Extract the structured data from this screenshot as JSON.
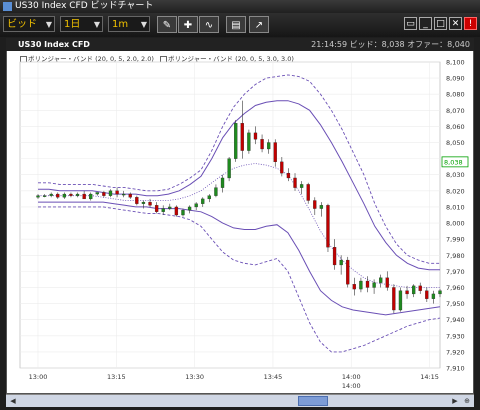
{
  "window": {
    "title": "US30 Index CFD ビッドチャート"
  },
  "toolbar": {
    "price_type": "ビッド",
    "period": "1日",
    "interval": "1m",
    "tool_icons": [
      "pen-icon",
      "pin-icon",
      "tilde-icon",
      "print-icon",
      "export-icon"
    ],
    "window_controls": [
      "window-icon",
      "minimize-icon",
      "maximize-icon",
      "close-icon",
      "alert-icon"
    ]
  },
  "chart_header": {
    "symbol": "US30 Index CFD",
    "status": "21:14:59  ビッド：8,038  オファー：8,040"
  },
  "legend": {
    "item1": "ボリンジャー・バンド (20, 0, 5, 2.0, 2.0)",
    "item2": "ボリンジャー・バンド (20, 0, 5, 3.0, 3.0)"
  },
  "colors": {
    "up": "#1f8a1f",
    "down": "#c00000",
    "band": "#6a4fb5",
    "accent": "#00a000"
  },
  "chart_data": {
    "type": "candlestick",
    "ylim": [
      7910,
      8100
    ],
    "yticks": [
      8100,
      8090,
      8080,
      8070,
      8060,
      8050,
      8040,
      8030,
      8020,
      8010,
      8000,
      7990,
      7980,
      7970,
      7960,
      7950,
      7940,
      7930,
      7920,
      7910
    ],
    "xticks": [
      {
        "label": "13:00",
        "t": 0
      },
      {
        "label": "13:15",
        "t": 15
      },
      {
        "label": "13:30",
        "t": 30
      },
      {
        "label": "13:45",
        "t": 45
      },
      {
        "label": "14:00",
        "t": 60
      },
      {
        "label": "14:15",
        "t": 75
      }
    ],
    "x_sublabel": {
      "label": "14:00",
      "t": 60
    },
    "last_price": "8,038",
    "candles": [
      [
        8016,
        8018,
        8015,
        8017
      ],
      [
        8017,
        8018,
        8016,
        8017
      ],
      [
        8017,
        8019,
        8016,
        8018
      ],
      [
        8018,
        8019,
        8015,
        8016
      ],
      [
        8016,
        8019,
        8015,
        8018
      ],
      [
        8018,
        8019,
        8016,
        8017
      ],
      [
        8017,
        8019,
        8016,
        8018
      ],
      [
        8018,
        8020,
        8015,
        8015
      ],
      [
        8015,
        8019,
        8014,
        8018
      ],
      [
        8018,
        8019,
        8017,
        8019
      ],
      [
        8019,
        8020,
        8016,
        8017
      ],
      [
        8017,
        8021,
        8016,
        8020
      ],
      [
        8020,
        8022,
        8016,
        8018
      ],
      [
        8018,
        8020,
        8016,
        8018
      ],
      [
        8018,
        8019,
        8015,
        8016
      ],
      [
        8016,
        8017,
        8011,
        8012
      ],
      [
        8012,
        8014,
        8009,
        8013
      ],
      [
        8013,
        8015,
        8010,
        8011
      ],
      [
        8011,
        8013,
        8006,
        8007
      ],
      [
        8007,
        8011,
        8005,
        8009
      ],
      [
        8009,
        8012,
        8008,
        8010
      ],
      [
        8010,
        8011,
        8004,
        8005
      ],
      [
        8005,
        8009,
        8004,
        8008
      ],
      [
        8008,
        8011,
        8006,
        8010
      ],
      [
        8010,
        8013,
        8008,
        8012
      ],
      [
        8012,
        8016,
        8010,
        8015
      ],
      [
        8015,
        8018,
        8013,
        8017
      ],
      [
        8017,
        8024,
        8016,
        8022
      ],
      [
        8022,
        8030,
        8019,
        8028
      ],
      [
        8028,
        8041,
        8026,
        8040
      ],
      [
        8040,
        8064,
        8038,
        8062
      ],
      [
        8062,
        8076,
        8040,
        8045
      ],
      [
        8045,
        8058,
        8043,
        8056
      ],
      [
        8056,
        8060,
        8049,
        8052
      ],
      [
        8052,
        8055,
        8044,
        8046
      ],
      [
        8046,
        8052,
        8043,
        8050
      ],
      [
        8050,
        8052,
        8035,
        8038
      ],
      [
        8038,
        8041,
        8029,
        8031
      ],
      [
        8031,
        8034,
        8026,
        8028
      ],
      [
        8028,
        8031,
        8020,
        8022
      ],
      [
        8022,
        8026,
        8018,
        8024
      ],
      [
        8024,
        8025,
        8012,
        8014
      ],
      [
        8014,
        8016,
        8005,
        8009
      ],
      [
        8009,
        8013,
        8004,
        8011
      ],
      [
        8011,
        8012,
        7982,
        7985
      ],
      [
        7985,
        7990,
        7971,
        7974
      ],
      [
        7974,
        7980,
        7968,
        7977
      ],
      [
        7977,
        7979,
        7960,
        7962
      ],
      [
        7962,
        7966,
        7955,
        7959
      ],
      [
        7959,
        7966,
        7957,
        7964
      ],
      [
        7964,
        7967,
        7957,
        7960
      ],
      [
        7960,
        7965,
        7956,
        7963
      ],
      [
        7963,
        7968,
        7960,
        7966
      ],
      [
        7966,
        7970,
        7958,
        7960
      ],
      [
        7960,
        7962,
        7944,
        7946
      ],
      [
        7946,
        7960,
        7945,
        7958
      ],
      [
        7958,
        7961,
        7953,
        7956
      ],
      [
        7956,
        7962,
        7954,
        7961
      ],
      [
        7961,
        7963,
        7956,
        7958
      ],
      [
        7958,
        7960,
        7951,
        7953
      ],
      [
        7953,
        7958,
        7950,
        7956
      ],
      [
        7956,
        7959,
        7954,
        7958
      ]
    ],
    "bands": {
      "upper3": [
        8025,
        8025,
        8024,
        8024,
        8024,
        8024,
        8023,
        8022,
        8022,
        8021,
        8020,
        8020,
        8021,
        8024,
        8028,
        8033,
        8045,
        8060,
        8072,
        8080,
        8086,
        8090,
        8091,
        8092,
        8091,
        8088,
        8080,
        8070,
        8058,
        8044,
        8030,
        8012,
        7998,
        7987,
        7980,
        7977,
        7975,
        7975
      ],
      "upper2": [
        8021,
        8021,
        8020,
        8020,
        8020,
        8020,
        8019,
        8018,
        8018,
        8018,
        8017,
        8017,
        8018,
        8020,
        8024,
        8029,
        8040,
        8053,
        8062,
        8068,
        8073,
        8075,
        8076,
        8076,
        8074,
        8070,
        8061,
        8050,
        8038,
        8025,
        8012,
        7998,
        7988,
        7980,
        7975,
        7972,
        7971,
        7971
      ],
      "mid": [
        8017,
        8017,
        8017,
        8017,
        8017,
        8017,
        8016,
        8015,
        8014,
        8014,
        8014,
        8014,
        8014,
        8015,
        8017,
        8020,
        8025,
        8030,
        8034,
        8036,
        8037,
        8036,
        8034,
        8030,
        8020,
        8008,
        7995,
        7985,
        7977,
        7971,
        7966,
        7963,
        7962,
        7961,
        7960,
        7960,
        7960,
        7960
      ],
      "lower2": [
        8013,
        8013,
        8013,
        8013,
        8013,
        8013,
        8013,
        8012,
        8011,
        8010,
        8010,
        8009,
        8009,
        8009,
        8008,
        8007,
        8004,
        8000,
        7997,
        7996,
        7996,
        7998,
        7999,
        7994,
        7983,
        7970,
        7958,
        7952,
        7948,
        7946,
        7945,
        7944,
        7943,
        7944,
        7945,
        7946,
        7947,
        7948
      ],
      "lower3": [
        8010,
        8010,
        8010,
        8010,
        8010,
        8010,
        8010,
        8009,
        8008,
        8007,
        8006,
        8006,
        8005,
        8004,
        8002,
        7998,
        7990,
        7982,
        7977,
        7975,
        7974,
        7976,
        7978,
        7970,
        7954,
        7938,
        7926,
        7920,
        7920,
        7922,
        7924,
        7927,
        7930,
        7933,
        7936,
        7938,
        7940,
        7941
      ]
    }
  }
}
